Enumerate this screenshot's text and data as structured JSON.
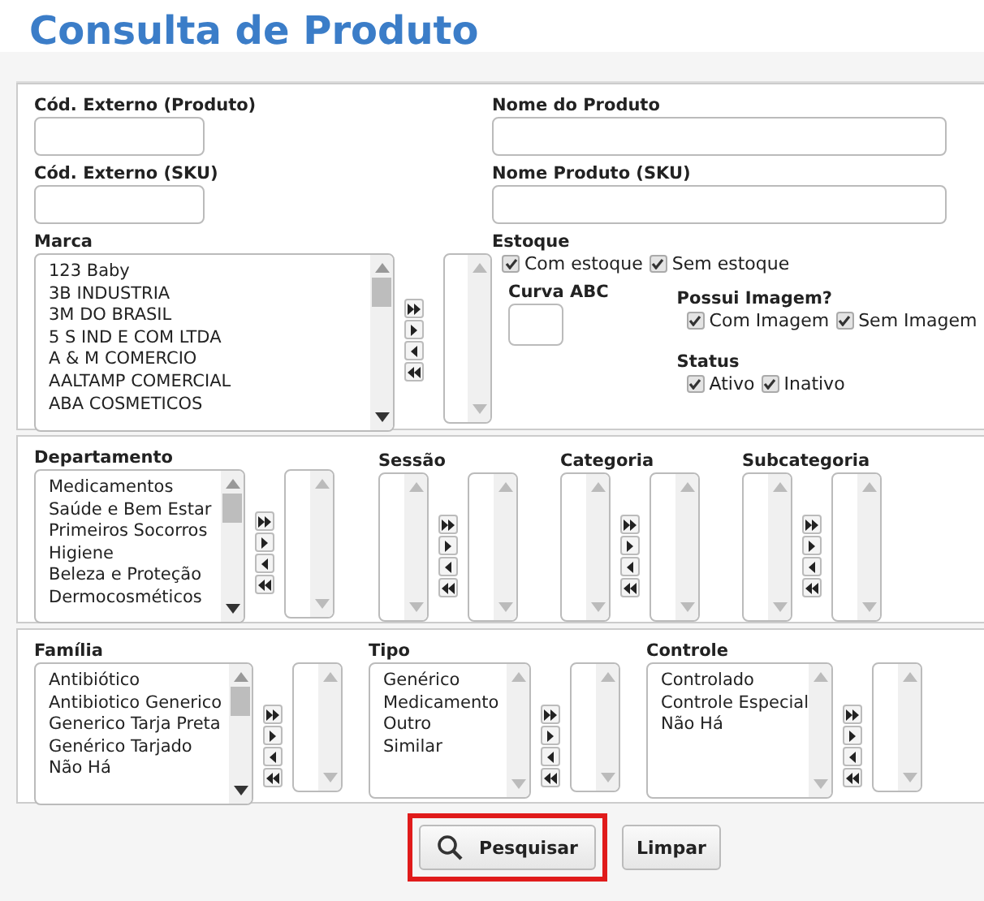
{
  "title": "Consulta de Produto",
  "section1": {
    "left": {
      "fields": [
        {
          "label": "Cód. Externo (Produto)"
        },
        {
          "label": "Cód. Externo (SKU)"
        }
      ],
      "picker": {
        "label": "Marca",
        "items": [
          "123 Baby",
          "3B INDUSTRIA",
          "3M DO BRASIL",
          "5 S IND E COM LTDA",
          "A & M COMERCIO",
          "AALTAMP COMERCIAL",
          "ABA COSMETICOS"
        ]
      }
    },
    "right": {
      "fields": [
        {
          "label": "Nome do Produto"
        },
        {
          "label": "Nome Produto (SKU)"
        }
      ],
      "estoque": {
        "label": "Estoque",
        "options": [
          {
            "label": "Com estoque",
            "checked": true
          },
          {
            "label": "Sem estoque",
            "checked": true
          }
        ]
      },
      "curva": {
        "label": "Curva ABC"
      },
      "imagem": {
        "label": "Possui Imagem?",
        "options": [
          {
            "label": "Com Imagem",
            "checked": true
          },
          {
            "label": "Sem Imagem",
            "checked": true
          }
        ]
      },
      "status": {
        "label": "Status",
        "options": [
          {
            "label": "Ativo",
            "checked": true
          },
          {
            "label": "Inativo",
            "checked": true
          }
        ]
      }
    }
  },
  "section2": [
    {
      "label": "Departamento",
      "items": [
        "Medicamentos",
        "Saúde e Bem Estar",
        "Primeiros Socorros",
        "Higiene",
        "Beleza e Proteção",
        "Dermocosméticos"
      ]
    },
    {
      "label": "Sessão"
    },
    {
      "label": "Categoria"
    },
    {
      "label": "Subcategoria"
    }
  ],
  "section3": [
    {
      "label": "Família",
      "items": [
        "Antibiótico",
        "Antibiotico Generico",
        "Generico Tarja Preta",
        "Genérico Tarjado",
        "Não Há"
      ]
    },
    {
      "label": "Tipo",
      "items": [
        "Genérico",
        "Medicamento",
        "Outro",
        "Similar"
      ]
    },
    {
      "label": "Controle",
      "items": [
        "Controlado",
        "Controle Especial",
        "Não Há"
      ]
    }
  ],
  "buttons": [
    {
      "label": "Pesquisar",
      "kind": "search",
      "highlighted": true
    },
    {
      "label": "Limpar",
      "kind": "plain"
    }
  ]
}
